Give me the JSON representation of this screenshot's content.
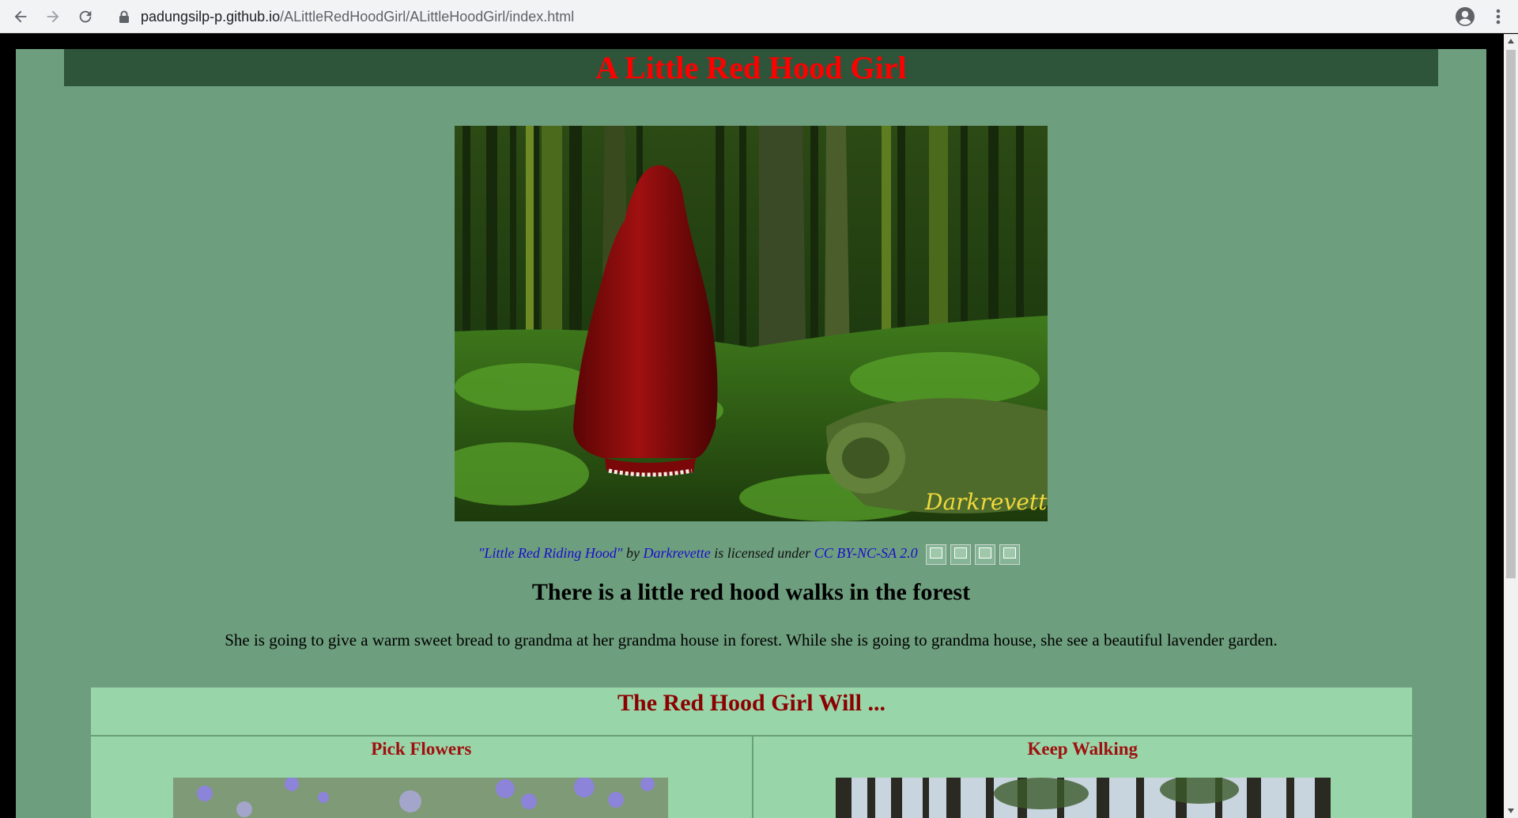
{
  "browser": {
    "url_host": "padungsilp-p.github.io",
    "url_path": "/ALittleRedHoodGirl/ALittleHoodGirl/index.html"
  },
  "page": {
    "title": "A Little Red Hood Girl",
    "credit": {
      "work_title": "\"Little Red Riding Hood\"",
      "by": "by",
      "author": "Darkrevette",
      "licensed": "is licensed under",
      "license": "CC BY-NC-SA 2.0"
    },
    "heading": "There is a little red hood walks in the forest",
    "paragraph": "She is going to give a warm sweet bread to grandma at her grandma house in forest. While she is going to grandma house, she see a beautiful lavender garden.",
    "choices": {
      "heading": "The Red Hood Girl Will ...",
      "left": "Pick Flowers",
      "right": "Keep Walking"
    },
    "hero_signature": "Darkrevette"
  },
  "colors": {
    "page_bg": "#6d9e7e",
    "title_bar": "#2e5439",
    "title_text": "#ff0000",
    "choice_bg": "#98d5a8",
    "choice_heading": "#8b0000",
    "link": "#1a0dcc"
  },
  "icons": [
    "back-arrow-icon",
    "forward-arrow-icon",
    "reload-icon",
    "lock-icon",
    "star-icon",
    "profile-icon",
    "menu-dots-icon"
  ]
}
